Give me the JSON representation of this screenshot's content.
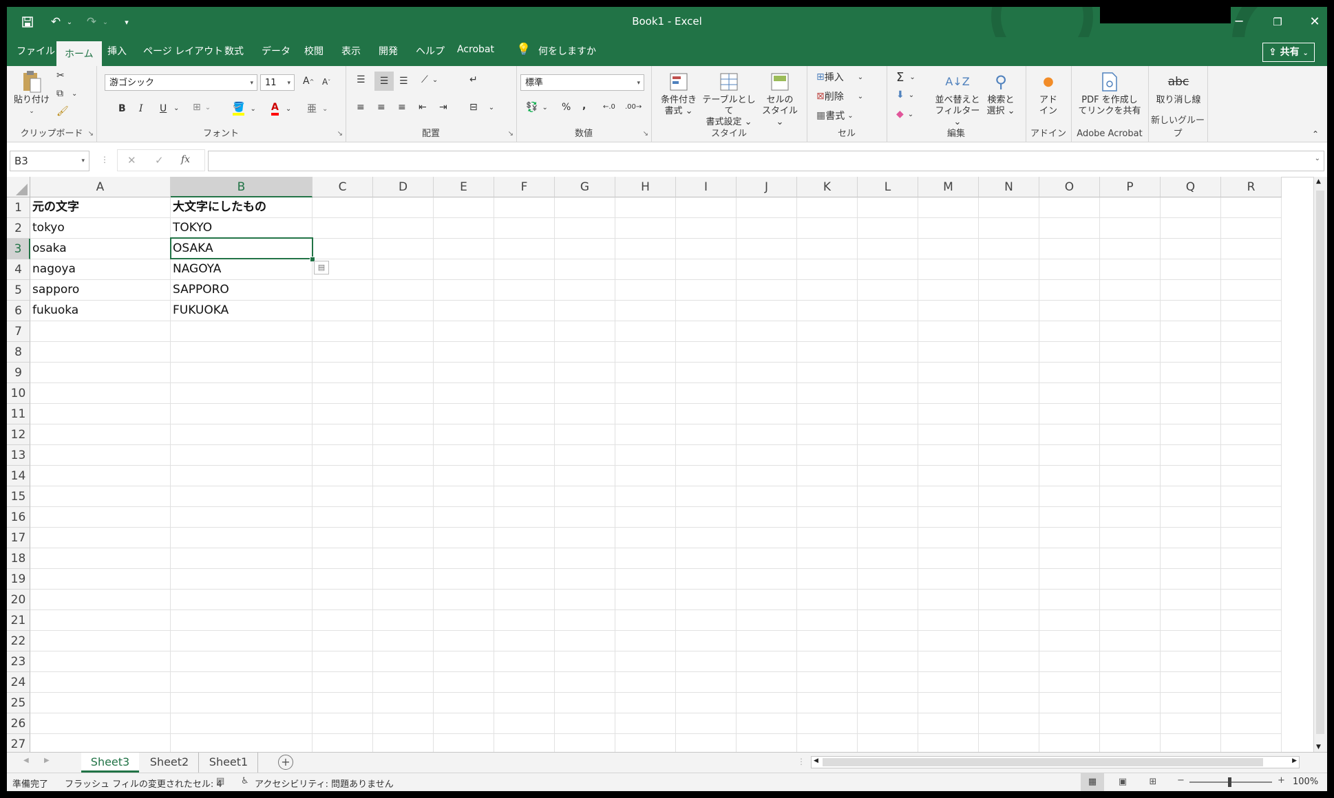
{
  "app": {
    "title": "Book1  -  Excel",
    "share_label": "共有"
  },
  "quick_access": {
    "save_icon": "save-icon",
    "undo_icon": "undo-icon",
    "redo_icon": "redo-icon",
    "customize": "▾"
  },
  "window_controls": {
    "minimize": "─",
    "restore": "❐",
    "close": "✕"
  },
  "ribbon_tabs": [
    {
      "label": "ファイル"
    },
    {
      "label": "ホーム"
    },
    {
      "label": "挿入"
    },
    {
      "label": "ページ レイアウト"
    },
    {
      "label": "数式"
    },
    {
      "label": "データ"
    },
    {
      "label": "校閲"
    },
    {
      "label": "表示"
    },
    {
      "label": "開発"
    },
    {
      "label": "ヘルプ"
    },
    {
      "label": "Acrobat"
    },
    {
      "label": "何をしますか"
    }
  ],
  "ribbon": {
    "clipboard": {
      "group": "クリップボード",
      "paste": "貼り付け"
    },
    "font": {
      "group": "フォント",
      "font_name": "游ゴシック",
      "font_size": "11",
      "bold": "B",
      "italic": "I",
      "underline": "U",
      "grow": "A",
      "shrink": "A"
    },
    "alignment": {
      "group": "配置"
    },
    "number": {
      "group": "数値",
      "format": "標準",
      "percent": "%",
      "comma": ","
    },
    "styles": {
      "group": "スタイル",
      "conditional_1": "条件付き",
      "conditional_2": "書式",
      "table_1": "テーブルとして",
      "table_2": "書式設定",
      "cell_1": "セルの",
      "cell_2": "スタイル"
    },
    "cells": {
      "group": "セル",
      "insert": "挿入",
      "delete": "削除",
      "format": "書式"
    },
    "editing": {
      "group": "編集",
      "sort_1": "並べ替えと",
      "sort_2": "フィルター",
      "find_1": "検索と",
      "find_2": "選択"
    },
    "addins": {
      "group": "アドイン",
      "label_1": "アド",
      "label_2": "イン"
    },
    "acrobat": {
      "group": "Adobe Acrobat",
      "label_1": "PDF を作成し",
      "label_2": "てリンクを共有"
    },
    "newgroup": {
      "group": "新しいグループ",
      "strike": "取り消し線",
      "strike_icon": "abc"
    }
  },
  "formula_bar": {
    "name_box": "B3",
    "fx": "fx",
    "value": ""
  },
  "sheet": {
    "columns": [
      "A",
      "B",
      "C",
      "D",
      "E",
      "F",
      "G",
      "H",
      "I",
      "J",
      "K",
      "L",
      "M",
      "N",
      "O",
      "P",
      "Q",
      "R"
    ],
    "rows": [
      "1",
      "2",
      "3",
      "4",
      "5",
      "6",
      "7",
      "8",
      "9",
      "10",
      "11",
      "12",
      "13",
      "14",
      "15",
      "16",
      "17",
      "18",
      "19",
      "20",
      "21",
      "22",
      "23",
      "24",
      "25",
      "26",
      "27"
    ],
    "selected_cell": "B3",
    "cells": {
      "A1": "元の文字",
      "B1": "大文字にしたもの",
      "A2": "tokyo",
      "B2": "TOKYO",
      "A3": "osaka",
      "B3": "OSAKA",
      "A4": "nagoya",
      "B4": "NAGOYA",
      "A5": "sapporo",
      "B5": "SAPPORO",
      "A6": "fukuoka",
      "B6": "FUKUOKA"
    }
  },
  "sheet_tabs": [
    {
      "label": "Sheet3",
      "active": true
    },
    {
      "label": "Sheet2"
    },
    {
      "label": "Sheet1"
    }
  ],
  "status": {
    "ready": "準備完了",
    "flash_fill": "フラッシュ フィルの変更されたセル: 4",
    "accessibility": "アクセシビリティ: 問題ありません",
    "zoom": "100%"
  },
  "colors": {
    "accent": "#217346",
    "ribbon_bg": "#f3f3f3",
    "grid_line": "#e1e1e1"
  }
}
